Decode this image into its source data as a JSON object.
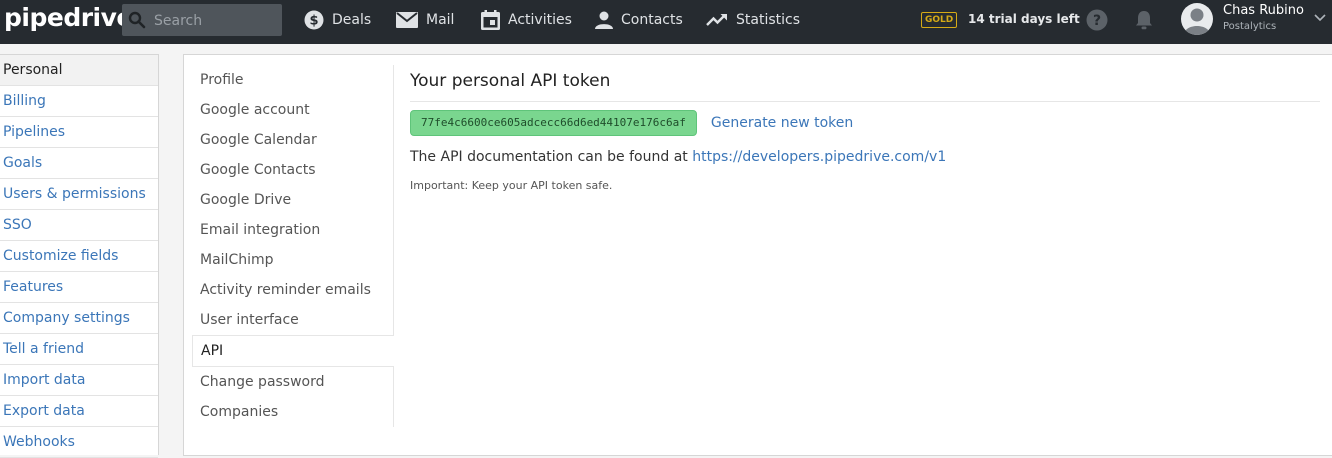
{
  "header": {
    "logo": "pipedrive",
    "search_placeholder": "Search",
    "nav": [
      {
        "label": "Deals",
        "icon": "dollar-icon"
      },
      {
        "label": "Mail",
        "icon": "mail-icon"
      },
      {
        "label": "Activities",
        "icon": "calendar-icon"
      },
      {
        "label": "Contacts",
        "icon": "person-icon"
      },
      {
        "label": "Statistics",
        "icon": "trend-icon"
      }
    ],
    "badge": "GOLD",
    "trial_text": "14 trial days left",
    "user_name": "Chas Rubino",
    "user_company": "Postalytics",
    "colors": {
      "bar": "#262b30",
      "gold": "#d5aa16"
    }
  },
  "sidebar": {
    "items": [
      {
        "label": "Personal"
      },
      {
        "label": "Billing"
      },
      {
        "label": "Pipelines"
      },
      {
        "label": "Goals"
      },
      {
        "label": "Users & permissions"
      },
      {
        "label": "SSO"
      },
      {
        "label": "Customize fields"
      },
      {
        "label": "Features"
      },
      {
        "label": "Company settings"
      },
      {
        "label": "Tell a friend"
      },
      {
        "label": "Import data"
      },
      {
        "label": "Export data"
      },
      {
        "label": "Webhooks"
      }
    ]
  },
  "subnav": {
    "items": [
      {
        "label": "Profile"
      },
      {
        "label": "Google account"
      },
      {
        "label": "Google Calendar"
      },
      {
        "label": "Google Contacts"
      },
      {
        "label": "Google Drive"
      },
      {
        "label": "Email integration"
      },
      {
        "label": "MailChimp"
      },
      {
        "label": "Activity reminder emails"
      },
      {
        "label": "User interface"
      },
      {
        "label": "API"
      },
      {
        "label": "Change password"
      },
      {
        "label": "Companies"
      }
    ]
  },
  "main": {
    "title": "Your personal API token",
    "token": "77fe4c6600ce605adcecc66d6ed44107e176c6af",
    "generate_label": "Generate new token",
    "doc_text": "The API documentation can be found at",
    "doc_link": "https://developers.pipedrive.com/v1",
    "note": "Important: Keep your API token safe.",
    "colors": {
      "token_bg": "#7ad68f",
      "link": "#3b76b8"
    }
  }
}
